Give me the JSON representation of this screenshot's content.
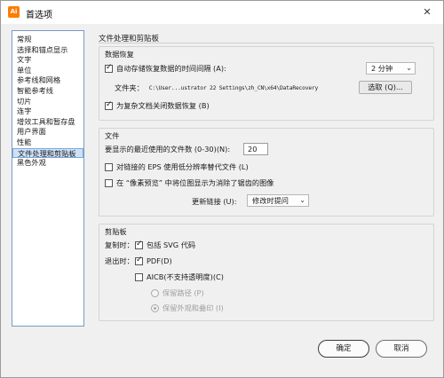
{
  "window": {
    "title": "首选项",
    "app_icon_text": "Ai",
    "close_glyph": "✕"
  },
  "sidebar": {
    "items": [
      "常规",
      "选择和锚点显示",
      "文字",
      "单位",
      "参考线和网格",
      "智能参考线",
      "切片",
      "连字",
      "增效工具和暂存盘",
      "用户界面",
      "性能",
      "文件处理和剪贴板",
      "黑色外观"
    ],
    "selected_index": 11
  },
  "main": {
    "header": "文件处理和剪贴板",
    "data_recovery": {
      "title": "数据恢复",
      "autosave_label": "自动存储恢复数据的时间间隔 (A):",
      "autosave_checked": true,
      "interval_value": "2 分钟",
      "folder_label": "文件夹：",
      "folder_path": "C:\\User...ustrator 22 Settings\\zh_CN\\x64\\DataRecovery",
      "choose_button": "选取 (Q)...",
      "disable_complex_label": "为复杂文档关闭数据恢复 (B)",
      "disable_complex_checked": true
    },
    "files": {
      "title": "文件",
      "recent_label": "要显示的最近使用的文件数 (0-30)(N):",
      "recent_value": "20",
      "eps_label": "对链接的 EPS 使用低分辨率替代文件 (L)",
      "eps_checked": false,
      "pixel_preview_label": "在 “像素预览” 中将位图显示为消除了锯齿的图像",
      "pixel_preview_checked": false,
      "update_links_label": "更新链接 (U):",
      "update_links_value": "修改时提问"
    },
    "clipboard": {
      "title": "剪贴板",
      "copy_as_label": "复制时：",
      "include_svg_label": "包括 SVG 代码",
      "include_svg_checked": true,
      "on_quit_label": "退出时：",
      "pdf_label": "PDF(D)",
      "pdf_checked": true,
      "aicb_label": "AICB(不支持透明度)(C)",
      "aicb_checked": false,
      "preserve_path_label": "保留路径 (P)",
      "preserve_appearance_label": "保留外观和叠印 (I)"
    }
  },
  "footer": {
    "ok_label": "确定",
    "cancel_label": "取消"
  },
  "icons": {
    "checkmark": "check-icon",
    "dropdown": "chevron-down-icon",
    "close": "close-icon"
  },
  "colors": {
    "selection_bg": "#cfe1f7",
    "selection_border": "#7aa7dc",
    "app_icon": "#ff7c00"
  }
}
